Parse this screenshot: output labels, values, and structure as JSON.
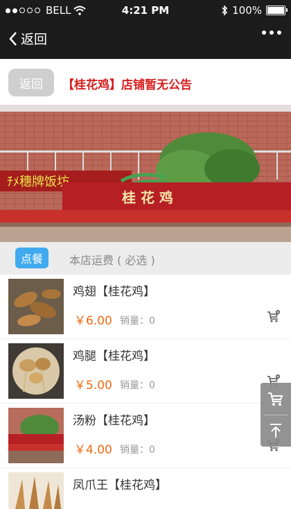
{
  "status_bar": {
    "carrier": "BELL",
    "time": "4:21 PM",
    "battery": "100%"
  },
  "nav": {
    "back_label": "返回"
  },
  "notice": {
    "back_button": "返回",
    "text": "【桂花鸡】店铺暂无公告"
  },
  "banner": {
    "sign_text": "桂 花 鸡"
  },
  "tabs": [
    {
      "label": "点餐",
      "active": true
    },
    {
      "label": "本店运费 ( 必选 )",
      "active": false
    }
  ],
  "products": [
    {
      "name": "鸡翅【桂花鸡】",
      "price": "￥6.00",
      "sales": "销量：0"
    },
    {
      "name": "鸡腿【桂花鸡】",
      "price": "￥5.00",
      "sales": "销量：0"
    },
    {
      "name": "汤粉【桂花鸡】",
      "price": "￥4.00",
      "sales": "销量：0"
    },
    {
      "name": "凤爪王【桂花鸡】",
      "price": "",
      "sales": ""
    }
  ],
  "colors": {
    "accent_blue": "#40aaf0",
    "price_orange": "#ee6b12",
    "notice_red": "#d61f1f"
  },
  "icons": {
    "cart": "shopping-cart-plus-icon",
    "top": "back-to-top-icon"
  }
}
